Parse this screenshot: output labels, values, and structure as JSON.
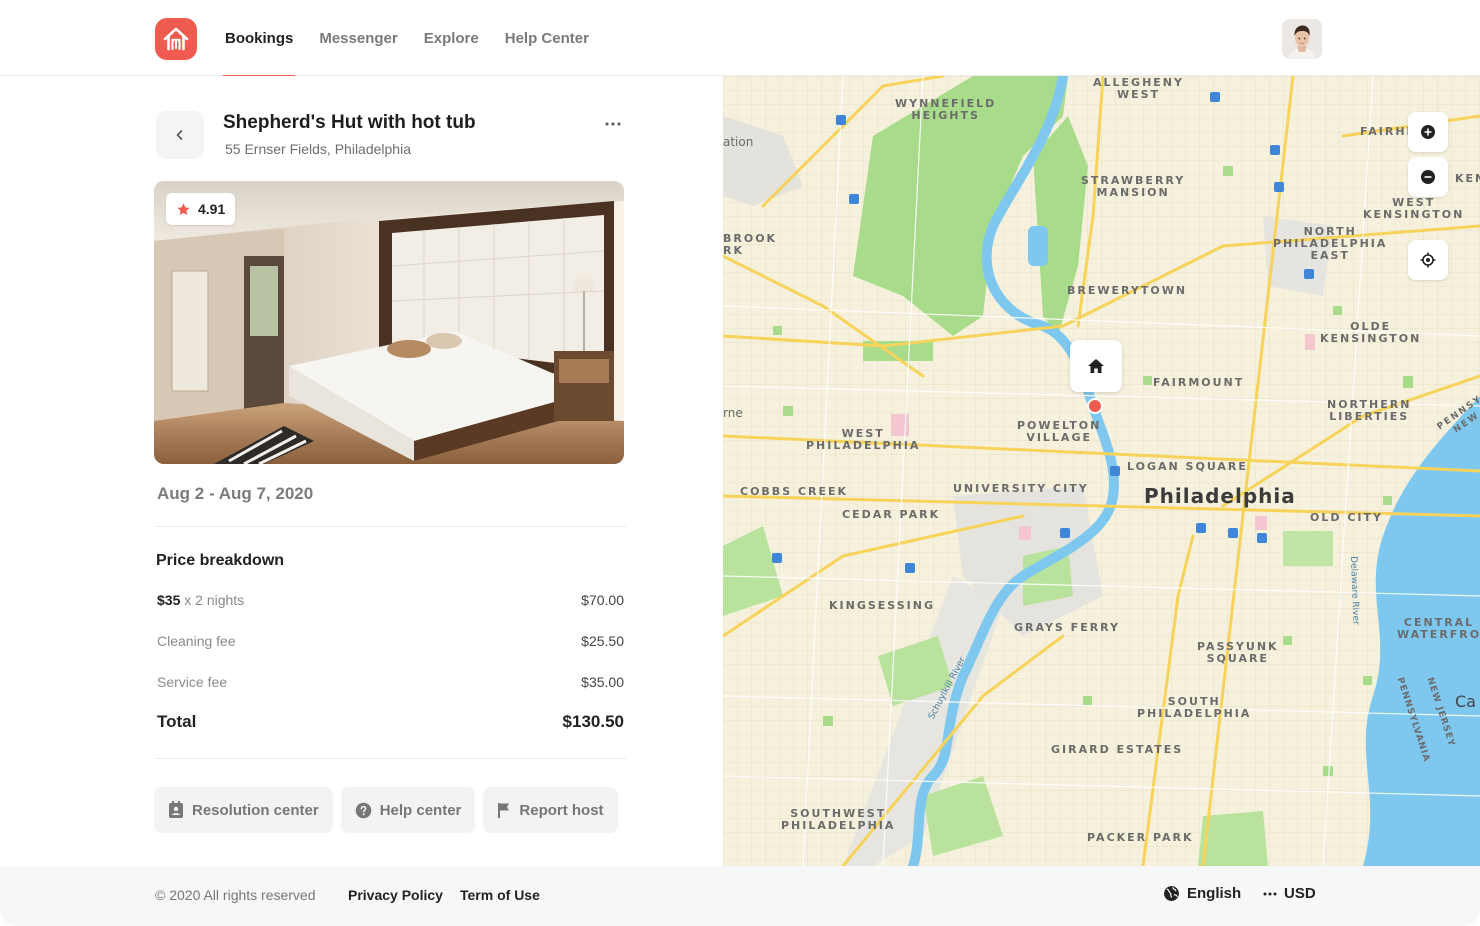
{
  "nav": {
    "items": [
      {
        "label": "Bookings",
        "active": true
      },
      {
        "label": "Messenger",
        "active": false
      },
      {
        "label": "Explore",
        "active": false
      },
      {
        "label": "Help Center",
        "active": false
      }
    ]
  },
  "listing": {
    "title": "Shepherd's Hut with hot tub",
    "address": "55 Ernser Fields, Philadelphia",
    "rating": "4.91",
    "dates": "Aug 2 - Aug 7, 2020"
  },
  "price": {
    "heading": "Price breakdown",
    "nightly_rate": "$35",
    "nights_text": "x 2 nights",
    "nights_total": "$70.00",
    "cleaning_label": "Cleaning fee",
    "cleaning_value": "$25.50",
    "service_label": "Service fee",
    "service_value": "$35.00",
    "total_label": "Total",
    "total_value": "$130.50"
  },
  "actions": {
    "resolution": "Resolution center",
    "help": "Help center",
    "report": "Report host"
  },
  "map": {
    "labels": {
      "allegheny": "ALLEGHENY\nWEST",
      "wynnefield": "WYNNEFIELD\nHEIGHTS",
      "ation": "ation",
      "fairhi": "FAIRHI",
      "ken": "KEN",
      "strawberry": "STRAWBERRY\nMANSION",
      "west_kensington": "WEST\nKENSINGTON",
      "brook": "BROOK\nRK",
      "north_philly": "NORTH\nPHILADELPHIA\nEAST",
      "brewerytown": "BREWERYTOWN",
      "olde_kensington": "OLDE\nKENSINGTON",
      "fairmount": "FAIRMOUNT",
      "rne": "rne",
      "northern_liberties": "NORTHERN\nLIBERTIES",
      "pennsy": "PENNSY\nNEW",
      "powelton": "POWELTON\nVILLAGE",
      "west_philly": "WEST\nPHILADELPHIA",
      "logan": "LOGAN SQUARE",
      "cobbs": "COBBS CREEK",
      "university": "UNIVERSITY CITY",
      "old_city": "OLD CITY",
      "cedar": "CEDAR PARK",
      "delaware": "Delaware River",
      "kingsessing": "KINGSESSING",
      "central": "CENTRAL\nWATERFRO",
      "grays": "GRAYS FERRY",
      "passyunk": "PASSYUNK\nSQUARE",
      "schuylkill": "Schuylkill River",
      "ca": "Ca",
      "south_philly": "SOUTH\nPHILADELPHIA",
      "nj": "NEW JERSEY",
      "pa": "PENNSYLVANIA",
      "girard": "GIRARD ESTATES",
      "southwest": "SOUTHWEST\nPHILADELPHIA",
      "packer": "PACKER PARK"
    },
    "city": "Philadelphia"
  },
  "footer": {
    "copyright": "© 2020 All rights reserved",
    "privacy": "Privacy Policy",
    "terms": "Term of Use",
    "language": "English",
    "currency": "USD"
  },
  "colors": {
    "accent": "#ef5b4f",
    "park": "#a8dc8a",
    "water": "#7ec8ef",
    "road": "#f7d35a"
  }
}
